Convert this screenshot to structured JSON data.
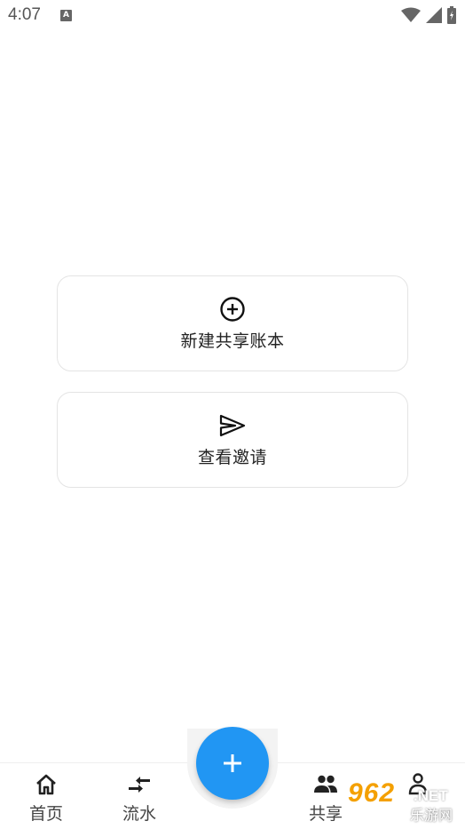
{
  "status_bar": {
    "time": "4:07",
    "app_icon_letter": "A",
    "icons": [
      "wifi-icon",
      "signal-icon",
      "battery-icon"
    ]
  },
  "cards": {
    "new_ledger": {
      "label": "新建共享账本",
      "icon": "add-circle-icon"
    },
    "view_invites": {
      "label": "查看邀请",
      "icon": "send-icon"
    }
  },
  "bottom_nav": {
    "items": [
      {
        "label": "首页",
        "icon": "home-icon"
      },
      {
        "label": "流水",
        "icon": "transfer-arrows-icon"
      },
      {
        "label": "共享",
        "icon": "people-icon"
      },
      {
        "label": "",
        "icon": "person-icon"
      }
    ],
    "fab_icon": "plus-icon"
  },
  "watermark": {
    "brand": "962",
    "suffix": ".NET",
    "text": "乐游网"
  },
  "colors": {
    "accent": "#2196f3",
    "background": "#ffffff",
    "card_border": "#e4e4e4"
  }
}
